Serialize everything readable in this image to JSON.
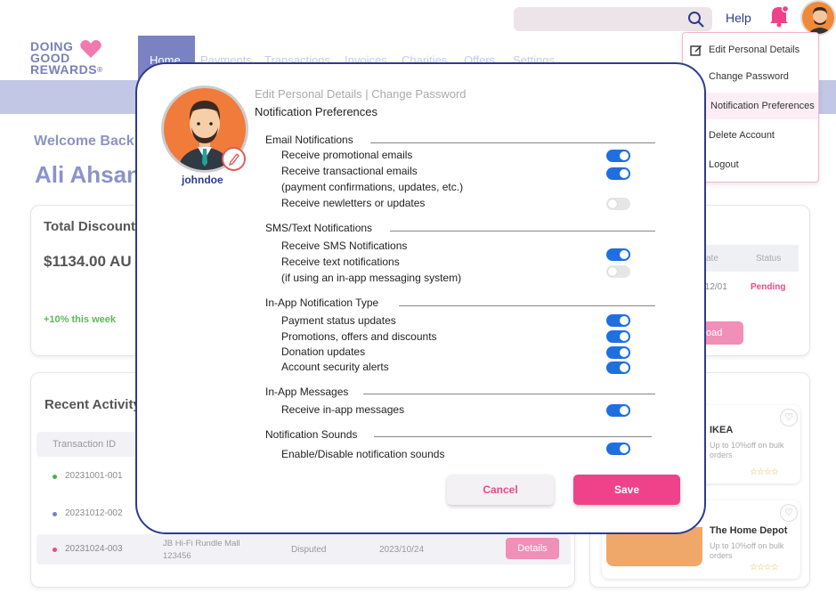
{
  "header": {
    "help": "Help"
  },
  "logo": {
    "line1": "DOING",
    "line2": "GOOD",
    "line3": "REWARDS",
    "mark": "®"
  },
  "nav": {
    "items": [
      "Home",
      "Payments",
      "Transactions",
      "Invoices",
      "Charities",
      "Offers",
      "Settings"
    ]
  },
  "welcome": {
    "greeting": "Welcome Back",
    "name": "Ali Ahsan"
  },
  "discount_card": {
    "title": "Total Discount",
    "amount": "$1134.00 AU",
    "trend": "+10% this week"
  },
  "right_card": {
    "col_date": "ate",
    "col_status": "Status",
    "date": "/12/01",
    "status": "Pending",
    "button": "oad"
  },
  "activity": {
    "title": "Recent Activity",
    "col_id": "Transaction ID",
    "rows": [
      {
        "id": "20231001-001",
        "dot": "#4caf50"
      },
      {
        "id": "20231012-002",
        "dot": "#7a82c4"
      },
      {
        "id": "20231024-003",
        "dot": "#e94a8a",
        "location": "JB Hi-Fi Rundle Mall 123456",
        "status": "Disputed",
        "date": "2023/10/24",
        "action": "Details"
      }
    ]
  },
  "offers": [
    {
      "name": "IKEA",
      "desc": "Up to 10%off on bulk orders",
      "stars": "☆☆☆☆"
    },
    {
      "name": "The Home Depot",
      "desc": "Up to 10%off on bulk orders",
      "stars": "☆☆☆☆"
    }
  ],
  "menu": {
    "items": [
      "Edit  Personal Details",
      "Change Password",
      "Notification Preferences",
      "Delete Account",
      "Logout"
    ]
  },
  "modal": {
    "username": "johndoe",
    "crumb": "Edit Personal Details | Change Password",
    "title": "Notification Preferences",
    "sections": {
      "email": "Email Notifications",
      "sms": "SMS/Text Notifications",
      "inapp_type": "In-App Notification Type",
      "inapp_msg": "In-App Messages",
      "sounds": "Notification Sounds"
    },
    "items": {
      "promo": "Receive promotional emails",
      "trans": "Receive transactional emails",
      "trans_note": "(payment confirmations, updates, etc.)",
      "news": "Receive newletters or updates",
      "sms": "Receive SMS Notifications",
      "text": "Receive text notifications",
      "text_note": "(if using an in-app messaging system)",
      "pay": "Payment status updates",
      "promos": "Promotions, offers and discounts",
      "donation": "Donation updates",
      "security": "Account security alerts",
      "inapp": "Receive in-app messages",
      "sound": "Enable/Disable notification sounds"
    },
    "toggles": {
      "promo": true,
      "trans": true,
      "news": false,
      "sms": true,
      "text": false,
      "pay": true,
      "promos": true,
      "donation": true,
      "security": true,
      "inapp": true,
      "sound": true
    },
    "cancel": "Cancel",
    "save": "Save"
  },
  "colors": {
    "primary": "#2e3b8c",
    "accent": "#f0428a",
    "toggle_on": "#1f6fe0"
  }
}
